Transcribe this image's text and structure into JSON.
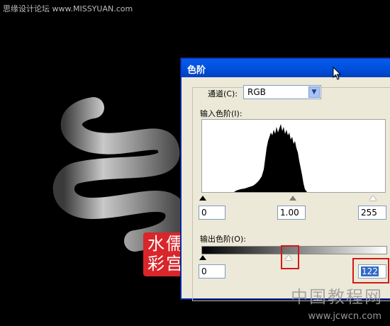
{
  "watermark_top": "思缘设计论坛  www.MISSYUAN.com",
  "dialog": {
    "title": "色阶",
    "channel_label": "通道(C):",
    "channel_value": "RGB",
    "input_label": "输入色阶(I):",
    "input_black": "0",
    "input_gamma": "1.00",
    "input_white": "255",
    "output_label": "输出色阶(O):",
    "output_black": "0",
    "output_white": "122"
  },
  "seal": {
    "chars": [
      "水",
      "儒",
      "彩",
      "宫"
    ]
  },
  "watermark_bottom": "中国教程网",
  "watermark_url": "www.jcwcn.com",
  "colors": {
    "titlebar": "#0054e3",
    "dialog_bg": "#ece9d8",
    "highlight": "#d41818",
    "seal": "#d8262b"
  },
  "icons": [
    "mouse-cursor-icon",
    "dropdown-arrow-icon",
    "slider-handle-icon"
  ]
}
